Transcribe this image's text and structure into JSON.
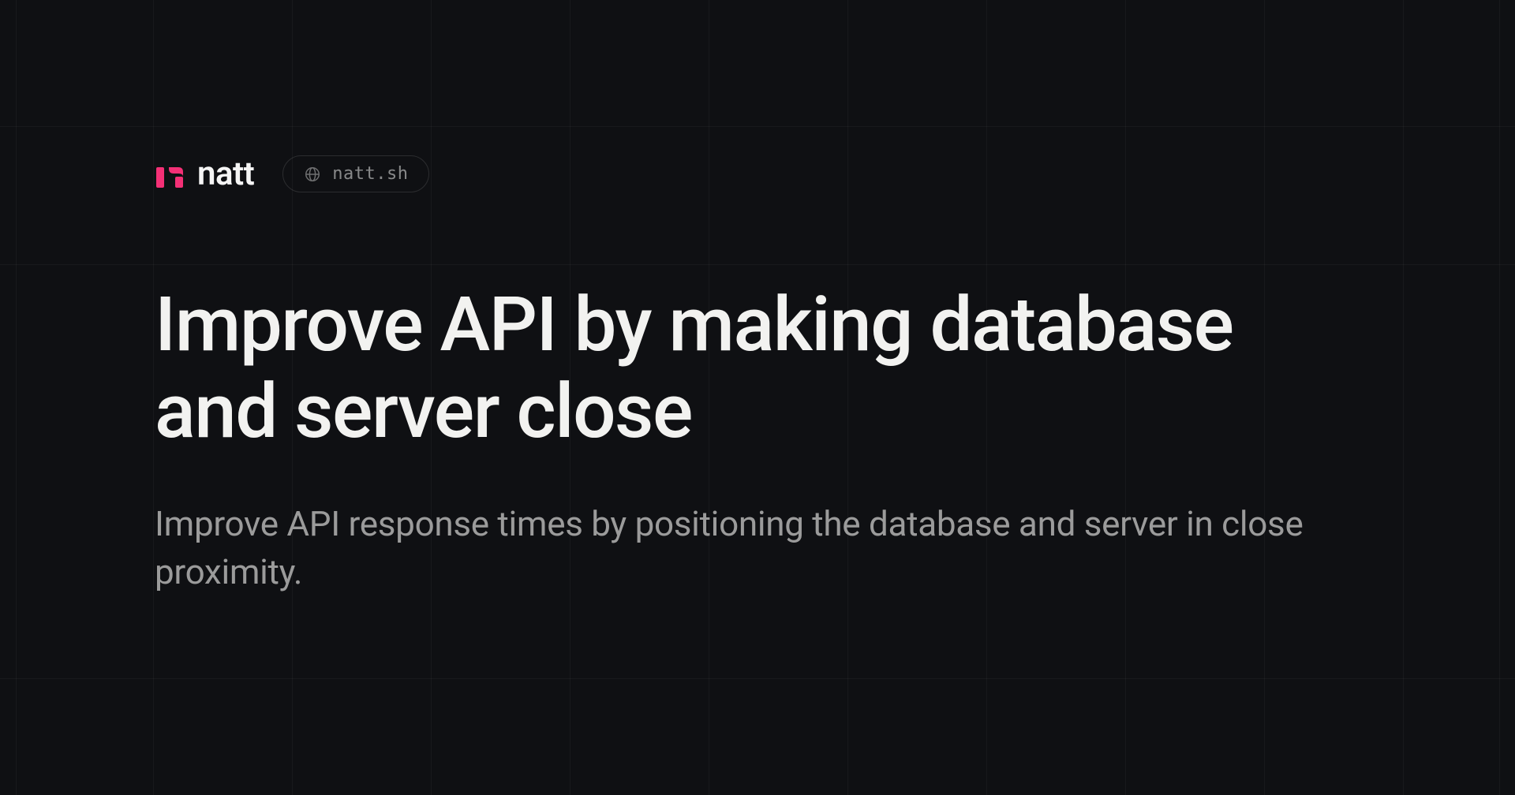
{
  "brand": {
    "name": "natt",
    "logo_color": "#f43076"
  },
  "domain_pill": {
    "text": "natt.sh"
  },
  "hero": {
    "title": "Improve API by making database and server close",
    "subtitle": "Improve API response times by positioning the database and server in close proximity."
  },
  "colors": {
    "background": "#0f1013",
    "text_primary": "#f2f2f0",
    "text_muted": "#9b9b9b",
    "accent": "#f43076"
  }
}
